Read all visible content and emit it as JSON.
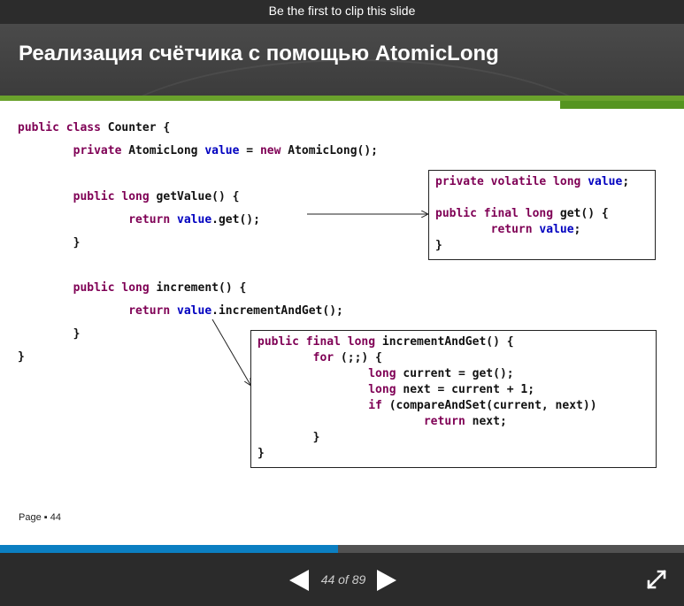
{
  "topbar": {
    "clip_text": "Be the first to clip this slide"
  },
  "slide": {
    "title": "Реализация счётчика с помощью AtomicLong",
    "page_label": "Page ▪ 44",
    "main_code": [
      [
        {
          "t": "public class ",
          "c": "kw"
        },
        {
          "t": "Counter {",
          "c": ""
        }
      ],
      [
        {
          "t": "        private ",
          "c": "kw"
        },
        {
          "t": "AtomicLong ",
          "c": ""
        },
        {
          "t": "value",
          "c": "fld"
        },
        {
          "t": " = ",
          "c": ""
        },
        {
          "t": "new ",
          "c": "kw"
        },
        {
          "t": "AtomicLong();",
          "c": ""
        }
      ],
      [],
      [
        {
          "t": "        public long ",
          "c": "kw"
        },
        {
          "t": "getValue() {",
          "c": ""
        }
      ],
      [
        {
          "t": "                return ",
          "c": "kw"
        },
        {
          "t": "value",
          "c": "fld"
        },
        {
          "t": ".get();",
          "c": ""
        }
      ],
      [
        {
          "t": "        }",
          "c": ""
        }
      ],
      [],
      [
        {
          "t": "        public long ",
          "c": "kw"
        },
        {
          "t": "increment() {",
          "c": ""
        }
      ],
      [
        {
          "t": "                return ",
          "c": "kw"
        },
        {
          "t": "value",
          "c": "fld"
        },
        {
          "t": ".incrementAndGet();",
          "c": ""
        }
      ],
      [
        {
          "t": "        }",
          "c": ""
        }
      ],
      [
        {
          "t": "}",
          "c": ""
        }
      ]
    ],
    "box1_code": [
      [
        {
          "t": "private volatile long ",
          "c": "kw"
        },
        {
          "t": "value",
          "c": "fld"
        },
        {
          "t": ";",
          "c": ""
        }
      ],
      [],
      [
        {
          "t": "public final long ",
          "c": "kw"
        },
        {
          "t": "get() {",
          "c": ""
        }
      ],
      [
        {
          "t": "        return ",
          "c": "kw"
        },
        {
          "t": "value",
          "c": "fld"
        },
        {
          "t": ";",
          "c": ""
        }
      ],
      [
        {
          "t": "}",
          "c": ""
        }
      ]
    ],
    "box2_code": [
      [
        {
          "t": "public final long ",
          "c": "kw"
        },
        {
          "t": "incrementAndGet() {",
          "c": ""
        }
      ],
      [
        {
          "t": "        for ",
          "c": "kw"
        },
        {
          "t": "(;;) {",
          "c": ""
        }
      ],
      [
        {
          "t": "                long ",
          "c": "kw"
        },
        {
          "t": "current = get();",
          "c": ""
        }
      ],
      [
        {
          "t": "                long ",
          "c": "kw"
        },
        {
          "t": "next = current + 1;",
          "c": ""
        }
      ],
      [
        {
          "t": "                if ",
          "c": "kw"
        },
        {
          "t": "(compareAndSet(current, next))",
          "c": ""
        }
      ],
      [
        {
          "t": "                        return ",
          "c": "kw"
        },
        {
          "t": "next;",
          "c": ""
        }
      ],
      [
        {
          "t": "        }",
          "c": ""
        }
      ],
      [
        {
          "t": "}",
          "c": ""
        }
      ]
    ]
  },
  "player": {
    "counter_text": "44 of 89",
    "progress_fraction": 0.494
  },
  "colors": {
    "keyword": "#7f0055",
    "field": "#0000c0",
    "accent_green": "#6aa22c",
    "progress_blue": "#0b7fc2"
  },
  "icons": [
    "prev-arrow-icon",
    "next-arrow-icon",
    "fullscreen-icon"
  ]
}
